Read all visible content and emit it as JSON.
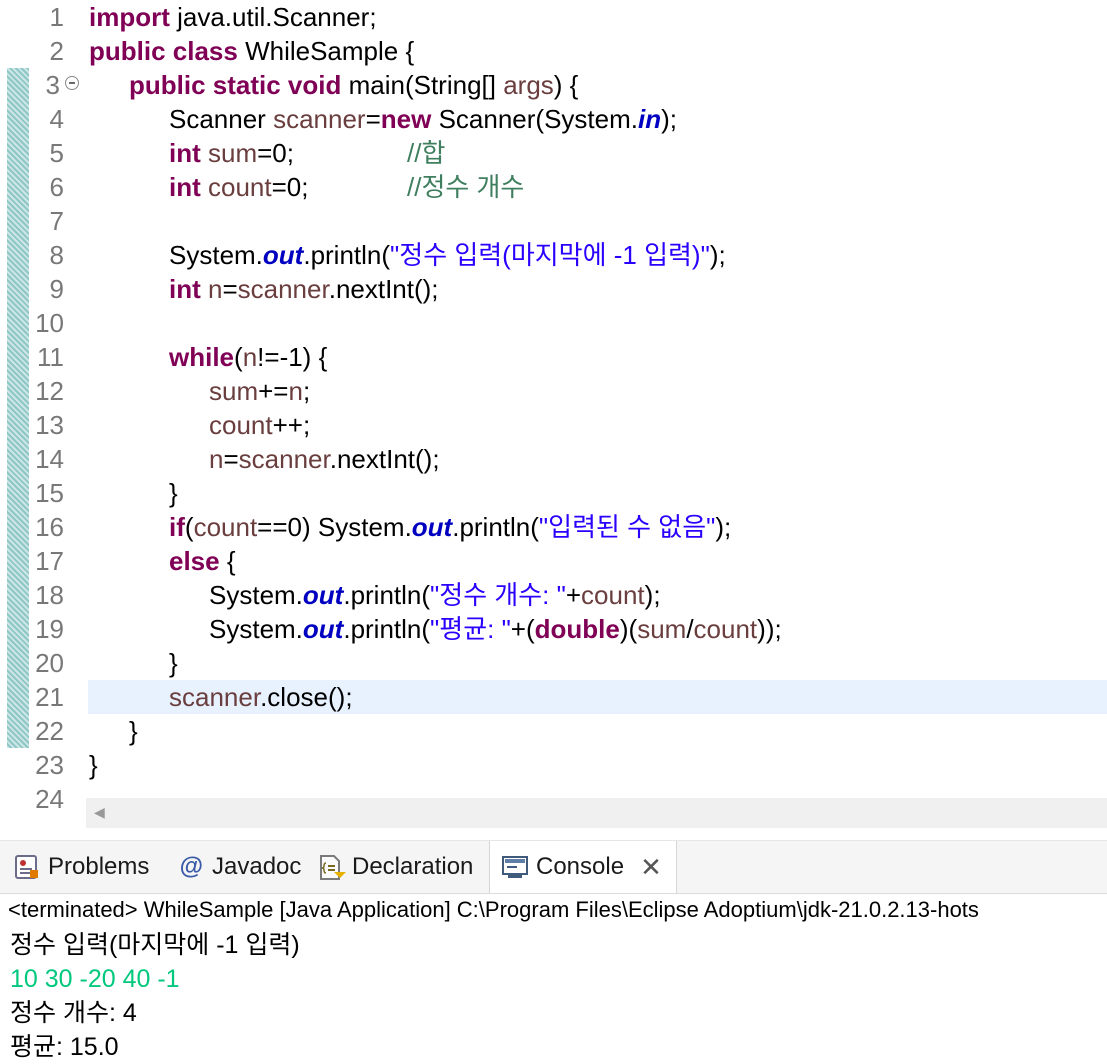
{
  "editor": {
    "line_numbers": [
      "1",
      "2",
      "3",
      "4",
      "5",
      "6",
      "7",
      "8",
      "9",
      "10",
      "11",
      "12",
      "13",
      "14",
      "15",
      "16",
      "17",
      "18",
      "19",
      "20",
      "21",
      "22",
      "23",
      "24"
    ],
    "code": {
      "l1": {
        "kw": "import",
        "rest": " java.util.Scanner;"
      },
      "l2": {
        "kw": "public class",
        "rest": " WhileSample {"
      },
      "l3": {
        "kw": "public static void",
        "rest": " main(String[] ",
        "var": "args",
        "end": ") {"
      },
      "l4": {
        "a": "Scanner ",
        "var": "scanner",
        "b": "=",
        "kw": "new",
        "c": " Scanner(System.",
        "static": "in",
        "d": ");"
      },
      "l5": {
        "kw": "int",
        "var": " sum",
        "b": "=0;",
        "cmt": "//합"
      },
      "l6": {
        "kw": "int",
        "var": " count",
        "b": "=0;",
        "cmt": "//정수 개수"
      },
      "l8": {
        "a": "System.",
        "static": "out",
        "b": ".println(",
        "str": "\"정수 입력(마지막에 -1 입력)\"",
        "c": ");"
      },
      "l9": {
        "kw": "int",
        "var": " n",
        "b": "=",
        "var2": "scanner",
        "c": ".nextInt();"
      },
      "l11": {
        "kw": "while",
        "a": "(",
        "var": "n",
        "b": "!=-1) {"
      },
      "l12": {
        "var": "sum",
        "a": "+=",
        "var2": "n",
        "b": ";"
      },
      "l13": {
        "var": "count",
        "a": "++;"
      },
      "l14": {
        "var": "n",
        "a": "=",
        "var2": "scanner",
        "b": ".nextInt();"
      },
      "l15": {
        "a": "}"
      },
      "l16": {
        "kw": "if",
        "a": "(",
        "var": "count",
        "b": "==0) System.",
        "static": "out",
        "c": ".println(",
        "str": "\"입력된 수 없음\"",
        "d": ");"
      },
      "l17": {
        "kw": "else",
        "a": " {"
      },
      "l18": {
        "a": "System.",
        "static": "out",
        "b": ".println(",
        "str": "\"정수 개수: \"",
        "c": "+",
        "var": "count",
        "d": ");"
      },
      "l19": {
        "a": "System.",
        "static": "out",
        "b": ".println(",
        "str": "\"평균: \"",
        "c": "+(",
        "kw": "double",
        "d": ")(",
        "var": "sum",
        "e": "/",
        "var2": "count",
        "f": "));"
      },
      "l20": {
        "a": "}"
      },
      "l21": {
        "var": "scanner",
        "a": ".close();"
      },
      "l22": {
        "a": "}"
      },
      "l23": {
        "a": "}"
      }
    }
  },
  "tabs": {
    "problems": "Problems",
    "javadoc": "Javadoc",
    "declaration": "Declaration",
    "console": "Console"
  },
  "console": {
    "header": "<terminated> WhileSample [Java Application] C:\\Program Files\\Eclipse Adoptium\\jdk-21.0.2.13-hots",
    "output": [
      "정수 입력(마지막에 -1 입력)",
      "10 30 -20 40 -1",
      "정수 개수: 4",
      "평균: 15.0"
    ]
  },
  "colors": {
    "keyword": "#7f0055",
    "variable": "#6a3e3e",
    "string": "#2a00ff",
    "comment": "#3f7f5f",
    "static_field": "#0000c0",
    "user_input": "#00c87d",
    "current_line": "#e8f2fe"
  },
  "icons": {
    "problems": "problems-icon",
    "javadoc": "at-sign-icon",
    "declaration": "declaration-icon",
    "console": "console-icon",
    "close": "close-icon",
    "fold": "collapse-icon"
  }
}
